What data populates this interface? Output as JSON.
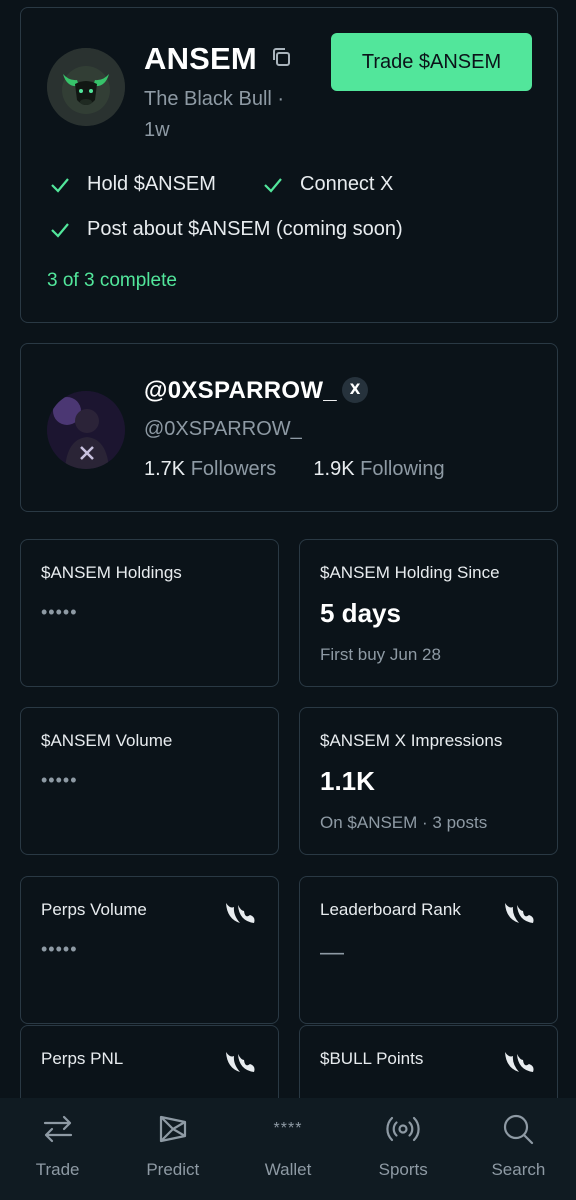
{
  "token": {
    "name": "ANSEM",
    "subtitle": "The Black Bull · 1w",
    "trade_button": "Trade $ANSEM",
    "tasks": [
      "Hold $ANSEM",
      "Connect X",
      "Post about $ANSEM (coming soon)"
    ],
    "progress": "3 of 3 complete"
  },
  "profile": {
    "name": "@0XSPARROW_",
    "badge": "X",
    "handle": "@0XSPARROW_",
    "followers_count": "1.7K",
    "followers_label": "Followers",
    "following_count": "1.9K",
    "following_label": "Following"
  },
  "stats": {
    "holdings": {
      "label": "$ANSEM Holdings",
      "value": "•••••"
    },
    "since": {
      "label": "$ANSEM Holding Since",
      "value": "5 days",
      "sub": "First buy Jun 28"
    },
    "volume": {
      "label": "$ANSEM Volume",
      "value": "•••••"
    },
    "impressions": {
      "label": "$ANSEM X Impressions",
      "value": "1.1K",
      "sub": "On $ANSEM · 3 posts"
    },
    "perps_volume": {
      "label": "Perps Volume",
      "value": "•••••"
    },
    "rank": {
      "label": "Leaderboard Rank",
      "value": "—"
    },
    "pnl": {
      "label": "Perps PNL"
    },
    "points": {
      "label": "$BULL Points"
    }
  },
  "nav": {
    "items": [
      {
        "label": "Trade",
        "icon": "swap-arrows-icon"
      },
      {
        "label": "Predict",
        "icon": "predict-icon"
      },
      {
        "label": "Wallet",
        "icon": "wallet-stars-icon",
        "glyph": "****"
      },
      {
        "label": "Sports",
        "icon": "broadcast-icon"
      },
      {
        "label": "Search",
        "icon": "search-icon"
      }
    ]
  },
  "colors": {
    "background": "#0b1319",
    "accent": "#52e69b",
    "border": "#2a3944",
    "muted": "#8e9aa4"
  }
}
